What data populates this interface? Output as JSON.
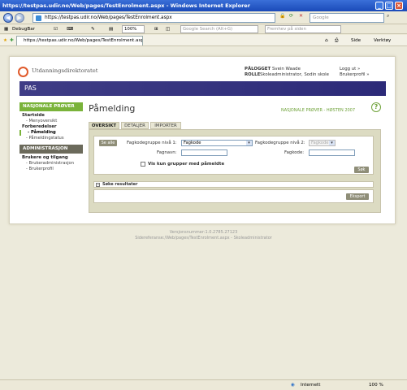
{
  "window": {
    "title": "https://testpas.udir.no/Web/pages/TestEnrolment.aspx - Windows Internet Explorer"
  },
  "address_bar": {
    "url": "https://testpas.udir.no/Web/pages/TestEnrolment.aspx",
    "search_placeholder": "Google"
  },
  "toolbar": {
    "debugbar_label": "DebugBar",
    "zoom": "100%",
    "google_search_placeholder": "Google Search (Alt+G)",
    "highlight_placeholder": "Fremhev på siden"
  },
  "browser_tab": {
    "label": "https://testpas.udir.no/Web/pages/TestEnrolment.aspx",
    "side_label": "Side",
    "tools_label": "Verktøy"
  },
  "site": {
    "logo_text": "Utdanningsdirektoratet",
    "banner": "PAS",
    "user": {
      "logged_label": "PÅLOGGET",
      "logged_value": "Svein Waade",
      "role_label": "ROLLE",
      "role_value": "Skoleadministrator, Sodin skole",
      "logout": "Logg ut »",
      "profile": "Brukerprofil »"
    }
  },
  "sidebar": {
    "section1_title": "NASJONALE PRØVER",
    "group1": "Startside",
    "group1_items": [
      "Menyoversikt"
    ],
    "group2": "Forberedelser",
    "group2_items": [
      "Påmelding",
      "Påmeldingstatus"
    ],
    "section2_title": "ADMINISTRASJON",
    "group3": "Brukere og tilgang",
    "group3_items": [
      "Brukeradministrasjon",
      "Brukerprofil"
    ]
  },
  "main": {
    "title": "Påmelding",
    "context": "NASJONALE PRØVER - HØSTEN 2007",
    "help": "?",
    "tabs": [
      "OVERSIKT",
      "DETALJER",
      "IMPORTER"
    ],
    "show_all": "Se alle",
    "fag1_label": "Fagkodegruppe nivå 1:",
    "fag1_value": "Fagkode",
    "fag2_label": "Fagkodegruppe nivå 2:",
    "fag2_value": "Fagkode",
    "fagnavn_label": "Fagnavn:",
    "fagkode_label": "Fagkode:",
    "checkbox_label": "Vis kun grupper med påmeldte",
    "search_button": "Søk",
    "results_header": "Søke resultater",
    "export_button": "Eksport"
  },
  "footer": {
    "version": "Versjonsnummer:1.0.2785.27123",
    "page_ref": "Sidereferanse:/Web/pages/TestEnrolment.aspx - Skoleadministrator"
  },
  "statusbar": {
    "zone": "Internett",
    "zoom": "100 %"
  }
}
